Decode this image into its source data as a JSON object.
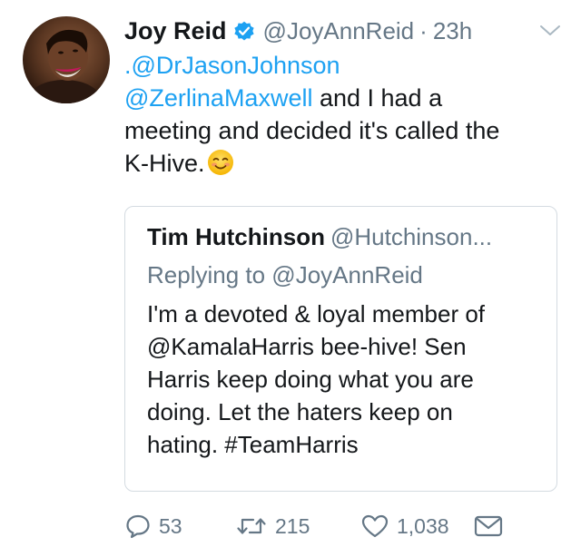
{
  "tweet": {
    "display_name": "Joy Reid",
    "verified": true,
    "handle": "@JoyAnnReid",
    "separator": "·",
    "time": "23h",
    "text_lines": [
      {
        "parts": [
          {
            "text": ".@DrJasonJohnson",
            "mention": true
          }
        ]
      },
      {
        "parts": [
          {
            "text": "@ZerlinaMaxwell",
            "mention": true
          },
          {
            "text": " and I had a",
            "mention": false
          }
        ]
      },
      {
        "parts": [
          {
            "text": "meeting and decided it's called the",
            "mention": false
          }
        ]
      },
      {
        "parts": [
          {
            "text": "K-Hive.",
            "mention": false
          }
        ]
      }
    ],
    "emoji": "smiling-face-emoji"
  },
  "quoted_tweet": {
    "display_name": "Tim Hutchinson",
    "handle": "@Hutchinson...",
    "replying_to": "Replying to @JoyAnnReid",
    "text_lines": [
      "I'm a devoted & loyal member of",
      "@KamalaHarris bee-hive! Sen",
      "Harris keep doing what you are",
      "doing. Let the haters keep on",
      "hating. #TeamHarris"
    ]
  },
  "actions": {
    "reply_count": "53",
    "retweet_count": "215",
    "like_count": "1,038",
    "icons": {
      "reply": "reply-icon",
      "retweet": "retweet-icon",
      "like": "heart-icon",
      "dm": "envelope-icon"
    }
  },
  "colors": {
    "text": "#14171a",
    "muted": "#657786",
    "link": "#1da1f2",
    "border": "#d4dbe1",
    "verified": "#1da1f2"
  }
}
